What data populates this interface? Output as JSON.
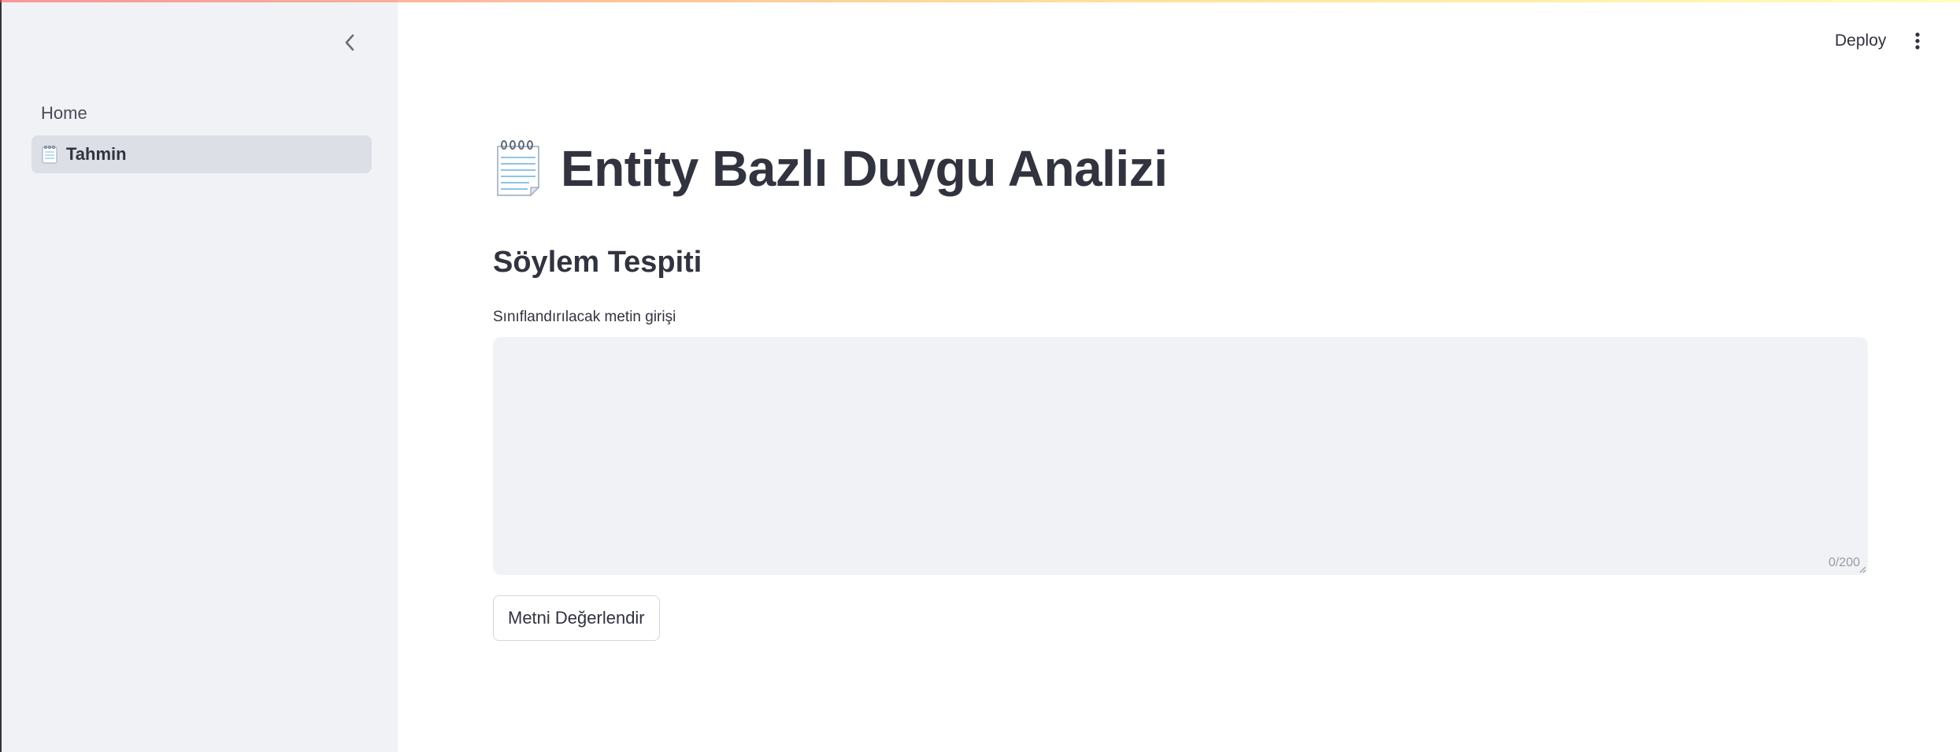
{
  "sidebar": {
    "collapse_icon": "chevron-left-icon",
    "items": [
      {
        "label": "Home",
        "icon": "",
        "active": false
      },
      {
        "label": "Tahmin",
        "icon": "notepad-icon",
        "active": true
      }
    ]
  },
  "header": {
    "deploy_label": "Deploy",
    "menu_icon": "kebab-menu-icon"
  },
  "main": {
    "title_icon": "notepad-icon",
    "title": "Entity Bazlı Duygu Analizi",
    "subheader": "Söylem Tespiti",
    "input": {
      "label": "Sınıflandırılacak metin girişi",
      "value": "",
      "char_count": "0/200"
    },
    "submit_label": "Metni Değerlendir"
  },
  "colors": {
    "sidebar_bg": "#f0f2f6",
    "active_item_bg": "#dcdfe6",
    "text": "#31333f",
    "accent_gradient_start": "#ff4b4b",
    "accent_gradient_end": "#fffd80"
  }
}
